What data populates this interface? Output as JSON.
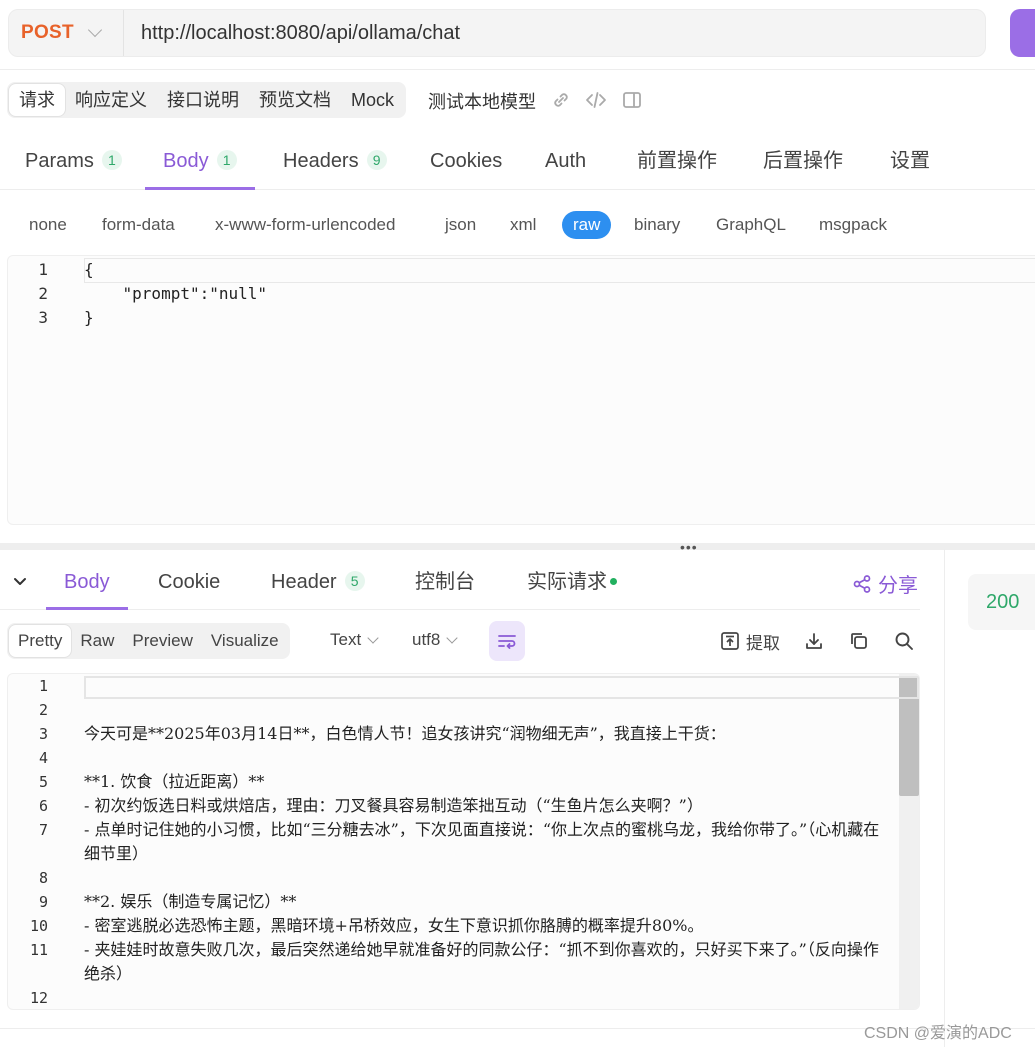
{
  "request": {
    "method": "POST",
    "url": "http://localhost:8080/api/ollama/chat",
    "status_code": "200"
  },
  "top_tabs": [
    {
      "label": "请求",
      "active": true
    },
    {
      "label": "响应定义"
    },
    {
      "label": "接口说明"
    },
    {
      "label": "预览文档"
    },
    {
      "label": "Mock"
    }
  ],
  "top_extra": "测试本地模型",
  "request_tabs": [
    {
      "label": "Params",
      "badge": "1"
    },
    {
      "label": "Body",
      "badge": "1",
      "active": true
    },
    {
      "label": "Headers",
      "badge": "9"
    },
    {
      "label": "Cookies"
    },
    {
      "label": "Auth"
    },
    {
      "label": "前置操作"
    },
    {
      "label": "后置操作"
    },
    {
      "label": "设置"
    }
  ],
  "body_types": [
    {
      "label": "none"
    },
    {
      "label": "form-data"
    },
    {
      "label": "x-www-form-urlencoded"
    },
    {
      "label": "json"
    },
    {
      "label": "xml"
    },
    {
      "label": "raw",
      "active": true
    },
    {
      "label": "binary"
    },
    {
      "label": "GraphQL"
    },
    {
      "label": "msgpack"
    }
  ],
  "request_body": {
    "lines": [
      {
        "num": "1",
        "text": "{"
      },
      {
        "num": "2",
        "text": "    \"prompt\":\"null\""
      },
      {
        "num": "3",
        "text": "}"
      }
    ]
  },
  "response_tabs": [
    {
      "label": "Body",
      "active": true
    },
    {
      "label": "Cookie"
    },
    {
      "label": "Header",
      "badge": "5"
    },
    {
      "label": "控制台"
    },
    {
      "label": "实际请求"
    }
  ],
  "share_label": "分享",
  "view_tabs": [
    {
      "label": "Pretty",
      "active": true
    },
    {
      "label": "Raw"
    },
    {
      "label": "Preview"
    },
    {
      "label": "Visualize"
    }
  ],
  "format_select": "Text",
  "encoding_select": "utf8",
  "extract_label": "提取",
  "response_body": {
    "lines": [
      {
        "num": "1",
        "text": ""
      },
      {
        "num": "2",
        "text": ""
      },
      {
        "num": "3",
        "text": "今天可是**2025年03月14日**，白色情人节！追女孩讲究“润物细无声”，我直接上干货："
      },
      {
        "num": "4",
        "text": ""
      },
      {
        "num": "5",
        "text": "**1. 饮食（拉近距离）**"
      },
      {
        "num": "6",
        "text": "- 初次约饭选日料或烘焙店，理由：刀叉餐具容易制造笨拙互动（“生鱼片怎么夹啊？”）"
      },
      {
        "num": "7",
        "text": "- 点单时记住她的小习惯，比如“三分糖去冰”，下次见面直接说：“你上次点的蜜桃乌龙，我给你带了。”（心机藏在细节里）"
      },
      {
        "num": "8",
        "text": ""
      },
      {
        "num": "9",
        "text": "**2. 娱乐（制造专属记忆）**"
      },
      {
        "num": "10",
        "text": "- 密室逃脱必选恐怖主题，黑暗环境+吊桥效应，女生下意识抓你胳膊的概率提升80%。"
      },
      {
        "num": "11",
        "text": "- 夹娃娃时故意失败几次，最后突然递给她早就准备好的同款公仔：“抓不到你喜欢的，只好买下来了。”（反向操作绝杀）"
      },
      {
        "num": "12",
        "text": ""
      }
    ]
  },
  "watermark": "CSDN @爱演的ADC"
}
